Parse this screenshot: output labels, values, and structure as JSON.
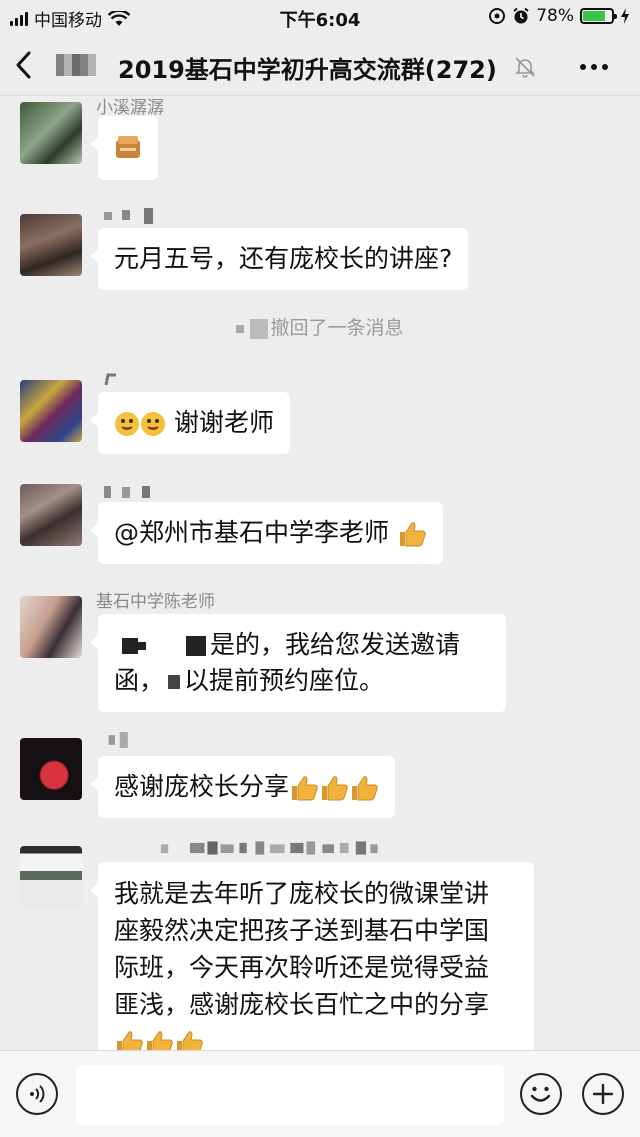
{
  "status_bar": {
    "carrier": "中国移动",
    "time": "下午6:04",
    "battery": "78%",
    "battery_level": 0.78
  },
  "nav": {
    "title": "2019基石中学初升高交流群(272)",
    "back_icon": "chevron-left-icon",
    "more_icon": "more-dots-icon",
    "mute_icon": "bell-muted-icon"
  },
  "messages": [
    {
      "sender": "小溪潺潺",
      "type": "sticker",
      "text": ""
    },
    {
      "sender": "",
      "type": "text",
      "text": "元月五号，还有庞校长的讲座?"
    },
    {
      "type": "system",
      "text": "撤回了一条消息"
    },
    {
      "sender": "",
      "type": "text",
      "text": "谢谢老师"
    },
    {
      "sender": "",
      "type": "text",
      "text": "@郑州市基石中学李老师"
    },
    {
      "sender": "基石中学陈老师",
      "type": "text",
      "line1": "是的，我给您发送邀请",
      "line2_pre": "函，",
      "line2": "以提前预约座位。"
    },
    {
      "sender": "",
      "type": "text",
      "text": "感谢庞校长分享"
    },
    {
      "sender": "",
      "type": "text",
      "lines": [
        "我就是去年听了庞校长的微课堂讲",
        "座毅然决定把孩子送到基石中学国",
        "际班，今天再次聆听还是觉得受益",
        "匪浅，感谢庞校长百忙之中的分享"
      ]
    }
  ],
  "colors": {
    "background": "#ededed",
    "bubble": "#ffffff",
    "battery_green": "#3cc34a",
    "thumb": "#f2b33d"
  }
}
